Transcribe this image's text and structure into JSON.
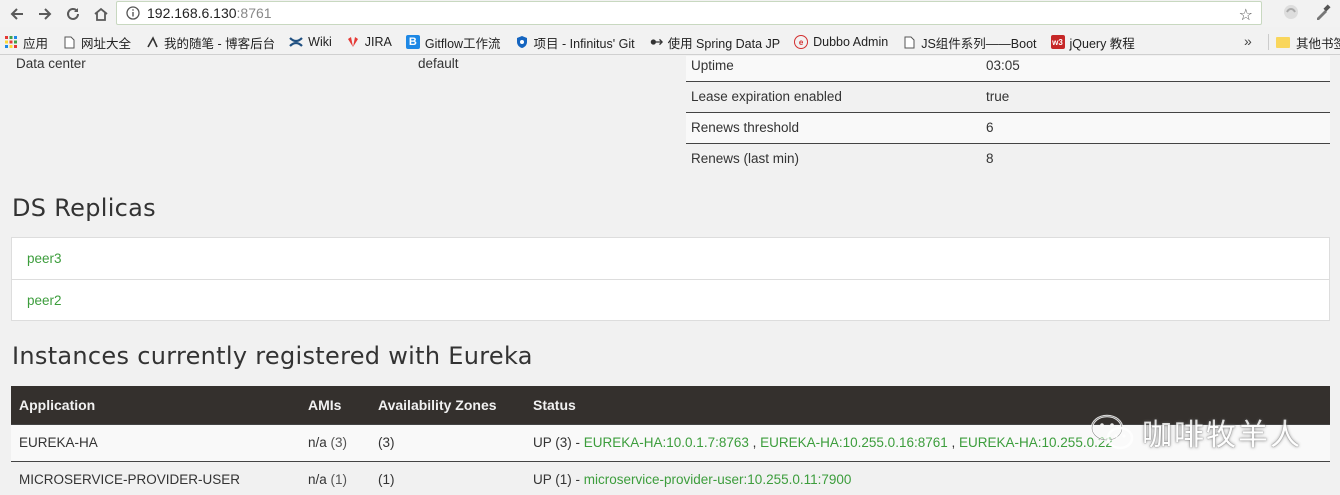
{
  "browser": {
    "url_host": "192.168.6.130",
    "url_port": ":8761",
    "bookmarks": [
      {
        "label": "应用",
        "icon": "apps-grid-icon",
        "color": "#e53935"
      },
      {
        "label": "网址大全",
        "icon": "page-icon",
        "color": "#555555"
      },
      {
        "label": "我的随笔 - 博客后台",
        "icon": "blog-icon",
        "color": "#333333"
      },
      {
        "label": "Wiki",
        "icon": "confluence-icon",
        "color": "#205081"
      },
      {
        "label": "JIRA",
        "icon": "huawei-icon",
        "color": "#e53935"
      },
      {
        "label": "Gitflow工作流",
        "icon": "bitbucket-icon",
        "color": "#1e88e5"
      },
      {
        "label": "项目 - Infinitus' Git",
        "icon": "gitlab-shield-icon",
        "color": "#1565c0"
      },
      {
        "label": "使用 Spring Data JP",
        "icon": "spring-icon",
        "color": "#333333"
      },
      {
        "label": "Dubbo Admin",
        "icon": "dubbo-icon",
        "color": "#d32f2f"
      },
      {
        "label": "JS组件系列——Boot",
        "icon": "page-icon",
        "color": "#555555"
      },
      {
        "label": "jQuery 教程",
        "icon": "w3-icon",
        "color": "#c62828"
      }
    ],
    "more_label": "»",
    "other_bookmarks": "其他书签"
  },
  "general": {
    "left_key": "Data center",
    "left_value": "default",
    "stats": [
      {
        "key": "Uptime",
        "value": "03:05"
      },
      {
        "key": "Lease expiration enabled",
        "value": "true"
      },
      {
        "key": "Renews threshold",
        "value": "6"
      },
      {
        "key": "Renews (last min)",
        "value": "8"
      }
    ]
  },
  "replicas": {
    "title": "DS Replicas",
    "items": [
      "peer3",
      "peer2"
    ]
  },
  "instances": {
    "title": "Instances currently registered with Eureka",
    "headers": [
      "Application",
      "AMIs",
      "Availability Zones",
      "Status"
    ],
    "rows": [
      {
        "application": "EUREKA-HA",
        "amis": "n/a",
        "amis_count": "(3)",
        "zones": "(3)",
        "status_prefix": "UP (3) - ",
        "links": [
          "EUREKA-HA:10.0.1.7:8763",
          "EUREKA-HA:10.255.0.16:8761",
          "EUREKA-HA:10.255.0.22"
        ],
        "separator": " , "
      },
      {
        "application": "MICROSERVICE-PROVIDER-USER",
        "amis": "n/a",
        "amis_count": "(1)",
        "zones": "(1)",
        "status_prefix": "UP (1) - ",
        "links": [
          "microservice-provider-user:10.255.0.11:7900"
        ],
        "separator": ""
      }
    ]
  },
  "watermark": {
    "text": "咖啡牧羊人",
    "icon": "wechat-icon"
  },
  "colors": {
    "link": "#3c9d3c",
    "header_bg": "#34302d",
    "page_bg": "#f1f1f1"
  }
}
